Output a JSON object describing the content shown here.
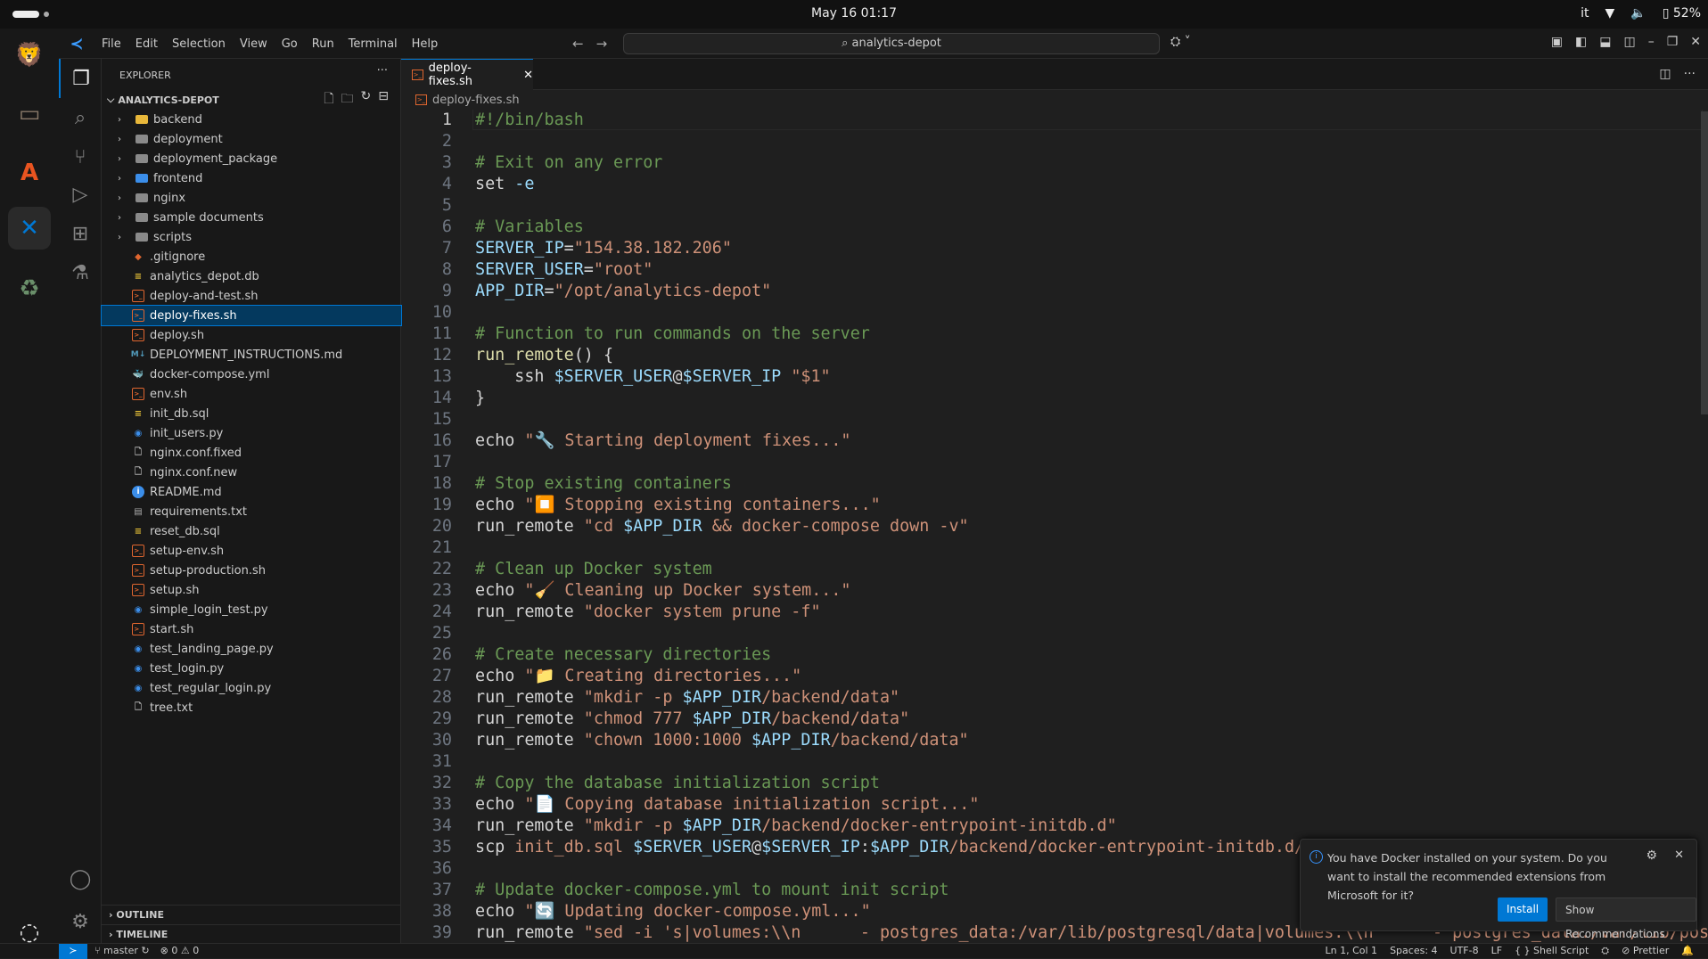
{
  "system": {
    "clock": "May 16  01:17",
    "keyboard": "it",
    "battery": "52%",
    "icons": [
      "wifi-icon",
      "volume-icon",
      "battery-icon"
    ]
  },
  "dock": [
    {
      "name": "brave",
      "color": "#fb542b",
      "glyph": "🦁"
    },
    {
      "name": "files",
      "color": "#8a7a6a",
      "glyph": "▭"
    },
    {
      "name": "app-center",
      "color": "#e95420",
      "glyph": "A"
    },
    {
      "name": "vscode",
      "color": "#0078d4",
      "glyph": "✕"
    },
    {
      "name": "trash",
      "color": "#6a8f6a",
      "glyph": "♻"
    }
  ],
  "menu": {
    "items": [
      "File",
      "Edit",
      "Selection",
      "View",
      "Go",
      "Run",
      "Terminal",
      "Help"
    ]
  },
  "search": {
    "value": "⌕ analytics-depot"
  },
  "explorer": {
    "title": "EXPLORER",
    "root": "ANALYTICS-DEPOT",
    "outline": "OUTLINE",
    "timeline": "TIMELINE",
    "items": [
      {
        "type": "folder-yellow",
        "name": "backend",
        "dir": true
      },
      {
        "type": "folder",
        "name": "deployment",
        "dir": true
      },
      {
        "type": "folder",
        "name": "deployment_package",
        "dir": true
      },
      {
        "type": "folder-blue",
        "name": "frontend",
        "dir": true
      },
      {
        "type": "folder",
        "name": "nginx",
        "dir": true
      },
      {
        "type": "folder",
        "name": "sample documents",
        "dir": true
      },
      {
        "type": "folder",
        "name": "scripts",
        "dir": true
      },
      {
        "type": "git",
        "name": ".gitignore"
      },
      {
        "type": "db",
        "name": "analytics_depot.db"
      },
      {
        "type": "shell",
        "name": "deploy-and-test.sh"
      },
      {
        "type": "shell",
        "name": "deploy-fixes.sh",
        "selected": true
      },
      {
        "type": "shell",
        "name": "deploy.sh"
      },
      {
        "type": "md",
        "name": "DEPLOYMENT_INSTRUCTIONS.md"
      },
      {
        "type": "docker",
        "name": "docker-compose.yml"
      },
      {
        "type": "shell",
        "name": "env.sh"
      },
      {
        "type": "db",
        "name": "init_db.sql"
      },
      {
        "type": "py",
        "name": "init_users.py"
      },
      {
        "type": "file",
        "name": "nginx.conf.fixed"
      },
      {
        "type": "file",
        "name": "nginx.conf.new"
      },
      {
        "type": "info",
        "name": "README.md"
      },
      {
        "type": "req",
        "name": "requirements.txt"
      },
      {
        "type": "db",
        "name": "reset_db.sql"
      },
      {
        "type": "shell",
        "name": "setup-env.sh"
      },
      {
        "type": "shell",
        "name": "setup-production.sh"
      },
      {
        "type": "shell",
        "name": "setup.sh"
      },
      {
        "type": "py",
        "name": "simple_login_test.py"
      },
      {
        "type": "shell",
        "name": "start.sh"
      },
      {
        "type": "py",
        "name": "test_landing_page.py"
      },
      {
        "type": "py",
        "name": "test_login.py"
      },
      {
        "type": "py",
        "name": "test_regular_login.py"
      },
      {
        "type": "file",
        "name": "tree.txt"
      }
    ]
  },
  "tab": {
    "label": "deploy-fixes.sh",
    "close": "✕"
  },
  "breadcrumb": "deploy-fixes.sh",
  "code": [
    [
      [
        "c",
        "#!/bin/bash"
      ]
    ],
    [],
    [
      [
        "c",
        "# Exit on any error"
      ]
    ],
    [
      [
        "t",
        "set "
      ],
      [
        "o",
        "-e"
      ]
    ],
    [],
    [
      [
        "c",
        "# Variables"
      ]
    ],
    [
      [
        "v",
        "SERVER_IP"
      ],
      [
        "t",
        "="
      ],
      [
        "s",
        "\"154.38.182.206\""
      ]
    ],
    [
      [
        "v",
        "SERVER_USER"
      ],
      [
        "t",
        "="
      ],
      [
        "s",
        "\"root\""
      ]
    ],
    [
      [
        "v",
        "APP_DIR"
      ],
      [
        "t",
        "="
      ],
      [
        "s",
        "\"/opt/analytics-depot\""
      ]
    ],
    [],
    [
      [
        "c",
        "# Function to run commands on the server"
      ]
    ],
    [
      [
        "f",
        "run_remote"
      ],
      [
        "t",
        "() {"
      ]
    ],
    [
      [
        "t",
        "    ssh "
      ],
      [
        "v",
        "$SERVER_USER"
      ],
      [
        "t",
        "@"
      ],
      [
        "v",
        "$SERVER_IP"
      ],
      [
        "t",
        " "
      ],
      [
        "s",
        "\"$1\""
      ]
    ],
    [
      [
        "t",
        "}"
      ]
    ],
    [],
    [
      [
        "t",
        "echo "
      ],
      [
        "s",
        "\"🔧 Starting deployment fixes...\""
      ]
    ],
    [],
    [
      [
        "c",
        "# Stop existing containers"
      ]
    ],
    [
      [
        "t",
        "echo "
      ],
      [
        "s",
        "\"⏹️ Stopping existing containers...\""
      ]
    ],
    [
      [
        "t",
        "run_remote "
      ],
      [
        "s",
        "\"cd "
      ],
      [
        "v",
        "$APP_DIR"
      ],
      [
        "s",
        " && docker-compose down -v\""
      ]
    ],
    [],
    [
      [
        "c",
        "# Clean up Docker system"
      ]
    ],
    [
      [
        "t",
        "echo "
      ],
      [
        "s",
        "\"🧹 Cleaning up Docker system...\""
      ]
    ],
    [
      [
        "t",
        "run_remote "
      ],
      [
        "s",
        "\"docker system prune -f\""
      ]
    ],
    [],
    [
      [
        "c",
        "# Create necessary directories"
      ]
    ],
    [
      [
        "t",
        "echo "
      ],
      [
        "s",
        "\"📁 Creating directories...\""
      ]
    ],
    [
      [
        "t",
        "run_remote "
      ],
      [
        "s",
        "\"mkdir -p "
      ],
      [
        "v",
        "$APP_DIR"
      ],
      [
        "s",
        "/backend/data\""
      ]
    ],
    [
      [
        "t",
        "run_remote "
      ],
      [
        "s",
        "\"chmod 777 "
      ],
      [
        "v",
        "$APP_DIR"
      ],
      [
        "s",
        "/backend/data\""
      ]
    ],
    [
      [
        "t",
        "run_remote "
      ],
      [
        "s",
        "\"chown 1000:1000 "
      ],
      [
        "v",
        "$APP_DIR"
      ],
      [
        "s",
        "/backend/data\""
      ]
    ],
    [],
    [
      [
        "c",
        "# Copy the database initialization script"
      ]
    ],
    [
      [
        "t",
        "echo "
      ],
      [
        "s",
        "\"📄 Copying database initialization script...\""
      ]
    ],
    [
      [
        "t",
        "run_remote "
      ],
      [
        "s",
        "\"mkdir -p "
      ],
      [
        "v",
        "$APP_DIR"
      ],
      [
        "s",
        "/backend/docker-entrypoint-initdb.d\""
      ]
    ],
    [
      [
        "t",
        "scp "
      ],
      [
        "s",
        "init_db.sql "
      ],
      [
        "v",
        "$SERVER_USER"
      ],
      [
        "t",
        "@"
      ],
      [
        "v",
        "$SERVER_IP"
      ],
      [
        "t",
        ":"
      ],
      [
        "v",
        "$APP_DIR"
      ],
      [
        "s",
        "/backend/docker-entrypoint-initdb.d/"
      ]
    ],
    [],
    [
      [
        "c",
        "# Update docker-compose.yml to mount init script"
      ]
    ],
    [
      [
        "t",
        "echo "
      ],
      [
        "s",
        "\"🔄 Updating docker-compose.yml...\""
      ]
    ],
    [
      [
        "t",
        "run_remote "
      ],
      [
        "s",
        "\"sed -i 's|volumes:\\\\n      - postgres_data:/var/lib/postgresql/data|volumes:\\\\n      - postgres_data:/var/lib/postgres"
      ]
    ]
  ],
  "notification": {
    "message": "You have Docker installed on your system. Do you want to install the recommended extensions from Microsoft for it?",
    "install": "Install",
    "show": "Show Recommendations"
  },
  "status": {
    "branch": "master",
    "problems": "⊗ 0 ⚠ 0",
    "position": "Ln 1, Col 1",
    "spaces": "Spaces: 4",
    "encoding": "UTF-8",
    "eol": "LF",
    "language": "{ } Shell Script",
    "prettier": "⊘ Prettier"
  },
  "colors": {
    "accent": "#0078d4",
    "comment": "#6a9955",
    "string": "#ce9178",
    "variable": "#9cdcfe"
  }
}
